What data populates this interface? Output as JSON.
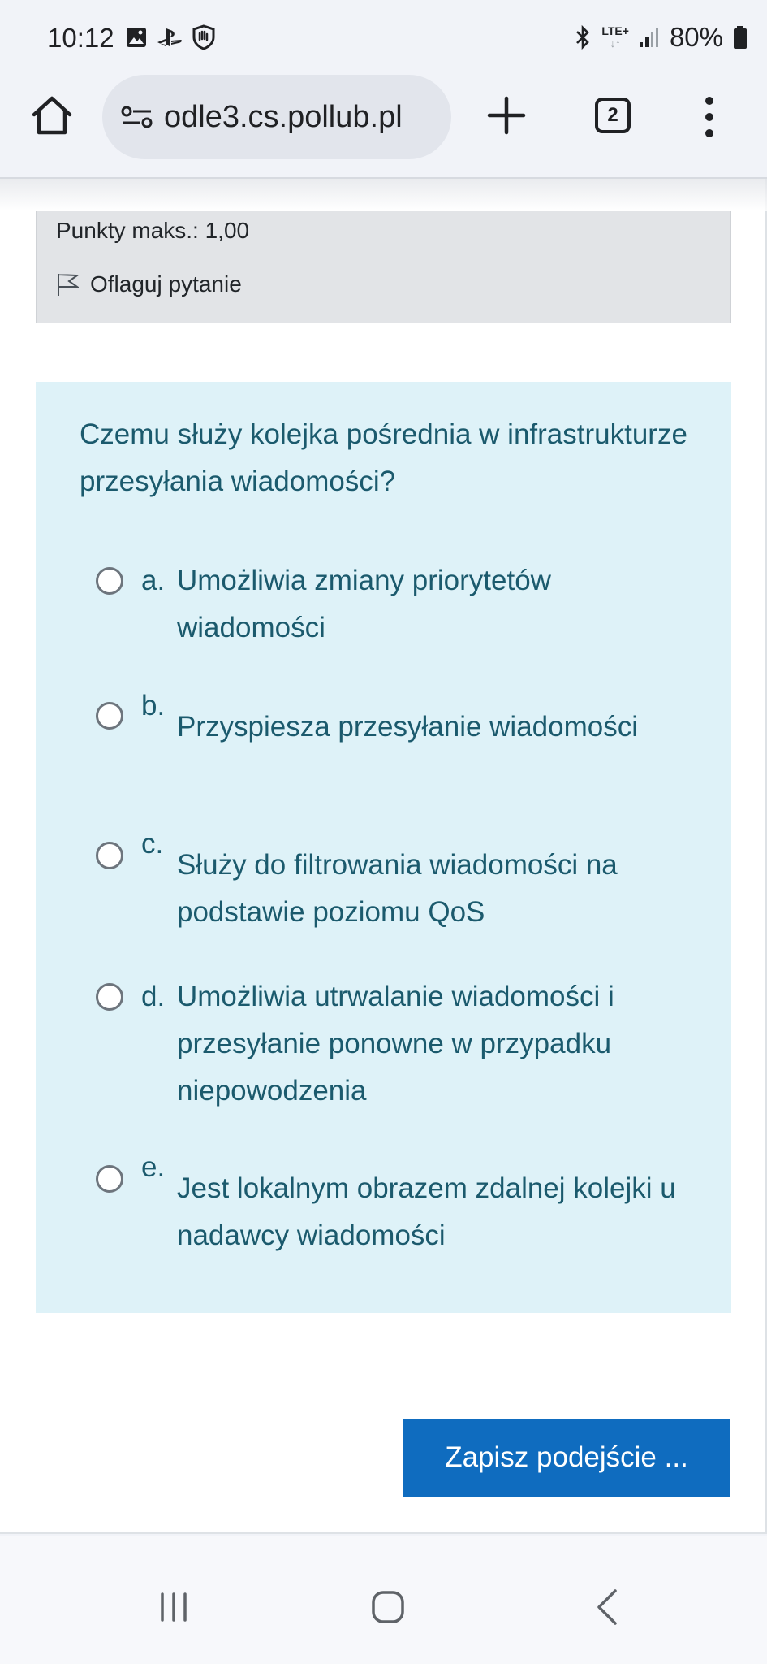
{
  "status_bar": {
    "time": "10:12",
    "battery": "80%",
    "network": "LTE+",
    "icons_left": [
      "gallery-icon",
      "playstation-icon",
      "shield-hand-icon"
    ],
    "icons_right": [
      "bluetooth-icon",
      "lte-icon",
      "signal-icon",
      "battery-icon"
    ]
  },
  "browser": {
    "url": "odle3.cs.pollub.pl",
    "tab_count": "2"
  },
  "question_info": {
    "max_points": "Punkty maks.: 1,00",
    "flag_label": "Oflaguj pytanie"
  },
  "question": {
    "text": "Czemu służy kolejka pośrednia w infrastrukturze przesyłania wiadomości?",
    "answers": [
      {
        "letter": "a.",
        "text": "Umożliwia zmiany priorytetów wiadomości"
      },
      {
        "letter": "b.",
        "text": "Przyspiesza przesyłanie wiadomości"
      },
      {
        "letter": "c.",
        "text": "Służy do filtrowania wiadomości na podstawie poziomu QoS"
      },
      {
        "letter": "d.",
        "text": "Umożliwia utrwalanie wiadomości i przesyłanie ponowne w przypadku niepowodzenia"
      },
      {
        "letter": "e.",
        "text": "Jest lokalnym obrazem zdalnej kolejki u nadawcy wiadomości"
      }
    ]
  },
  "save_button": "Zapisz podejście ...",
  "colors": {
    "accent": "#0f6cbf",
    "question_bg": "#def2f8",
    "question_text": "#1b5a6d"
  }
}
